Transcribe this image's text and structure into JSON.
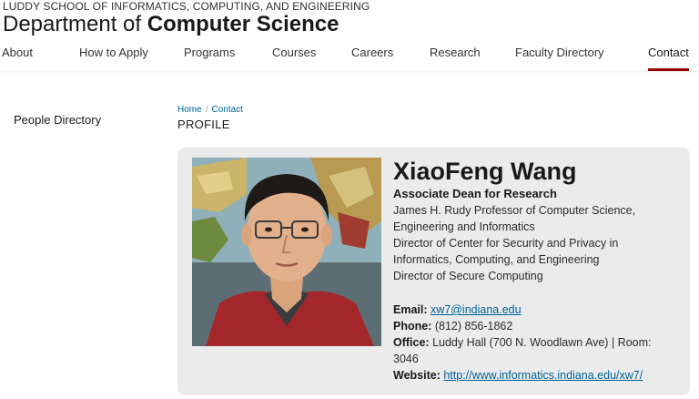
{
  "header": {
    "school": "LUDDY SCHOOL OF INFORMATICS, COMPUTING, AND ENGINEERING",
    "dept_prefix": "Department of",
    "dept_name": "Computer Science"
  },
  "nav": {
    "items": [
      "About",
      "How to Apply",
      "Programs",
      "Courses",
      "Careers",
      "Research",
      "Faculty Directory",
      "Contact"
    ],
    "active": "Contact",
    "accent_color": "#990000"
  },
  "sidebar": {
    "items": [
      "People Directory"
    ]
  },
  "breadcrumb": {
    "home": "Home",
    "separator": "/",
    "current": "Contact"
  },
  "page": {
    "section_label": "PROFILE"
  },
  "profile": {
    "name": "XiaoFeng Wang",
    "role": "Associate Dean for Research",
    "titles": [
      "James H. Rudy Professor of Computer Science,",
      "Engineering and Informatics",
      "Director of Center for Security and Privacy in",
      "Informatics, Computing, and Engineering",
      "Director of Secure Computing"
    ],
    "email_label": "Email:",
    "email": "xw7@indiana.edu",
    "phone_label": "Phone:",
    "phone": "(812) 856-1862",
    "office_label": "Office:",
    "office_line1": "Luddy Hall (700 N. Woodlawn Ave) | Room:",
    "office_line2": "3046",
    "website_label": "Website:",
    "website": "http://www.informatics.indiana.edu/xw7/"
  }
}
